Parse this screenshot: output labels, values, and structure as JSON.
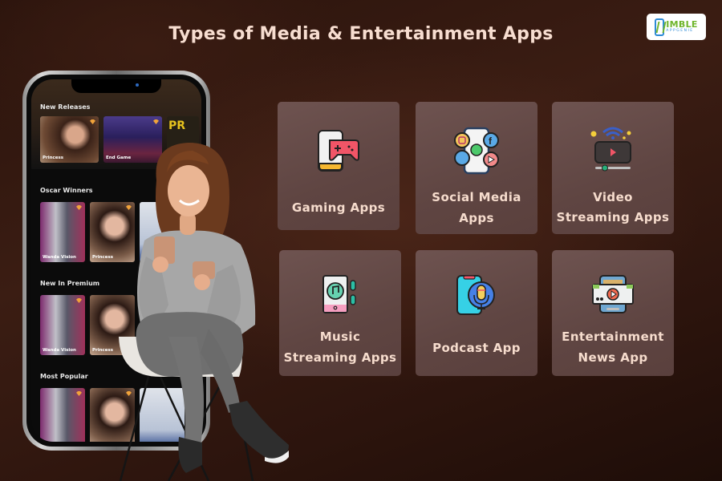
{
  "title": "Types of Media & Entertainment Apps",
  "logo": {
    "main": "IMBLE",
    "sub": "APPGENIE",
    "brand": "Nimble AppGenie"
  },
  "phone": {
    "sections": [
      {
        "label": "New Releases",
        "items": [
          "Princess",
          "End Game",
          "PR"
        ]
      },
      {
        "label": "Oscar Winners",
        "items": [
          "Wanda Vision",
          "Princess"
        ]
      },
      {
        "label": "New In Premium",
        "items": [
          "Wanda Vision",
          "Princess"
        ]
      },
      {
        "label": "Most Popular",
        "items": [
          "",
          ""
        ]
      }
    ]
  },
  "tiles": [
    {
      "label_lines": [
        "Gaming Apps"
      ],
      "icon": "gaming-icon"
    },
    {
      "label_lines": [
        "Social Media",
        "Apps"
      ],
      "icon": "social-media-icon"
    },
    {
      "label_lines": [
        "Video",
        "Streaming Apps"
      ],
      "icon": "video-streaming-icon"
    },
    {
      "label_lines": [
        "Music",
        "Streaming Apps"
      ],
      "icon": "music-streaming-icon"
    },
    {
      "label_lines": [
        "Podcast App"
      ],
      "icon": "podcast-icon"
    },
    {
      "label_lines": [
        "Entertainment",
        "News App"
      ],
      "icon": "entertainment-news-icon"
    }
  ],
  "colors": {
    "title": "#f7ddd0",
    "tile_bg": "#654a47",
    "background": "#2e150d"
  }
}
